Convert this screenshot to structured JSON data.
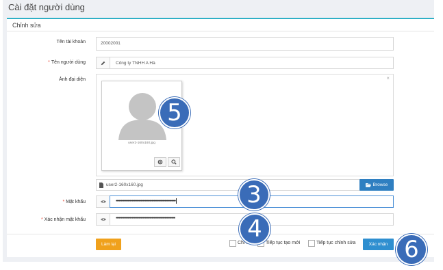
{
  "page": {
    "title": "Cài đặt người dùng"
  },
  "card": {
    "header": "Chỉnh sửa"
  },
  "form": {
    "account": {
      "label": "Tên tài khoản",
      "value": "20002001"
    },
    "user_name": {
      "required": "*",
      "label": "Tên người dùng",
      "value": "Công ty TNHH A Hà"
    },
    "avatar": {
      "label": "Ảnh đại diện",
      "thumb_caption": "user2-160x160.jpg",
      "file_name": "user2-160x160.jpg",
      "browse_label": "Browse",
      "close": "×"
    },
    "password": {
      "required": "*",
      "label": "Mật khẩu",
      "value": "••••••••••••••••••••••••••••••••••••••••••••••••••••••••••••"
    },
    "confirm_password": {
      "required": "*",
      "label": "Xác nhận mật khẩu",
      "value": "••••••••••••••••••••••••••••••••••••••••••••••••••••••••••••"
    }
  },
  "footer": {
    "reset_label": "Làm lại",
    "options": [
      {
        "label": "Chi tiết"
      },
      {
        "label": "Tiếp tục tạo mới"
      },
      {
        "label": "Tiếp tục chỉnh sửa"
      }
    ],
    "confirm_label": "Xác nhận"
  },
  "callouts": {
    "c3": "3",
    "c4": "4",
    "c5": "5",
    "c6": "6"
  },
  "colors": {
    "accent": "#2fb0c6",
    "primary": "#2f7fc1",
    "warning": "#f0a11c",
    "callout": "#3a6cb8"
  }
}
